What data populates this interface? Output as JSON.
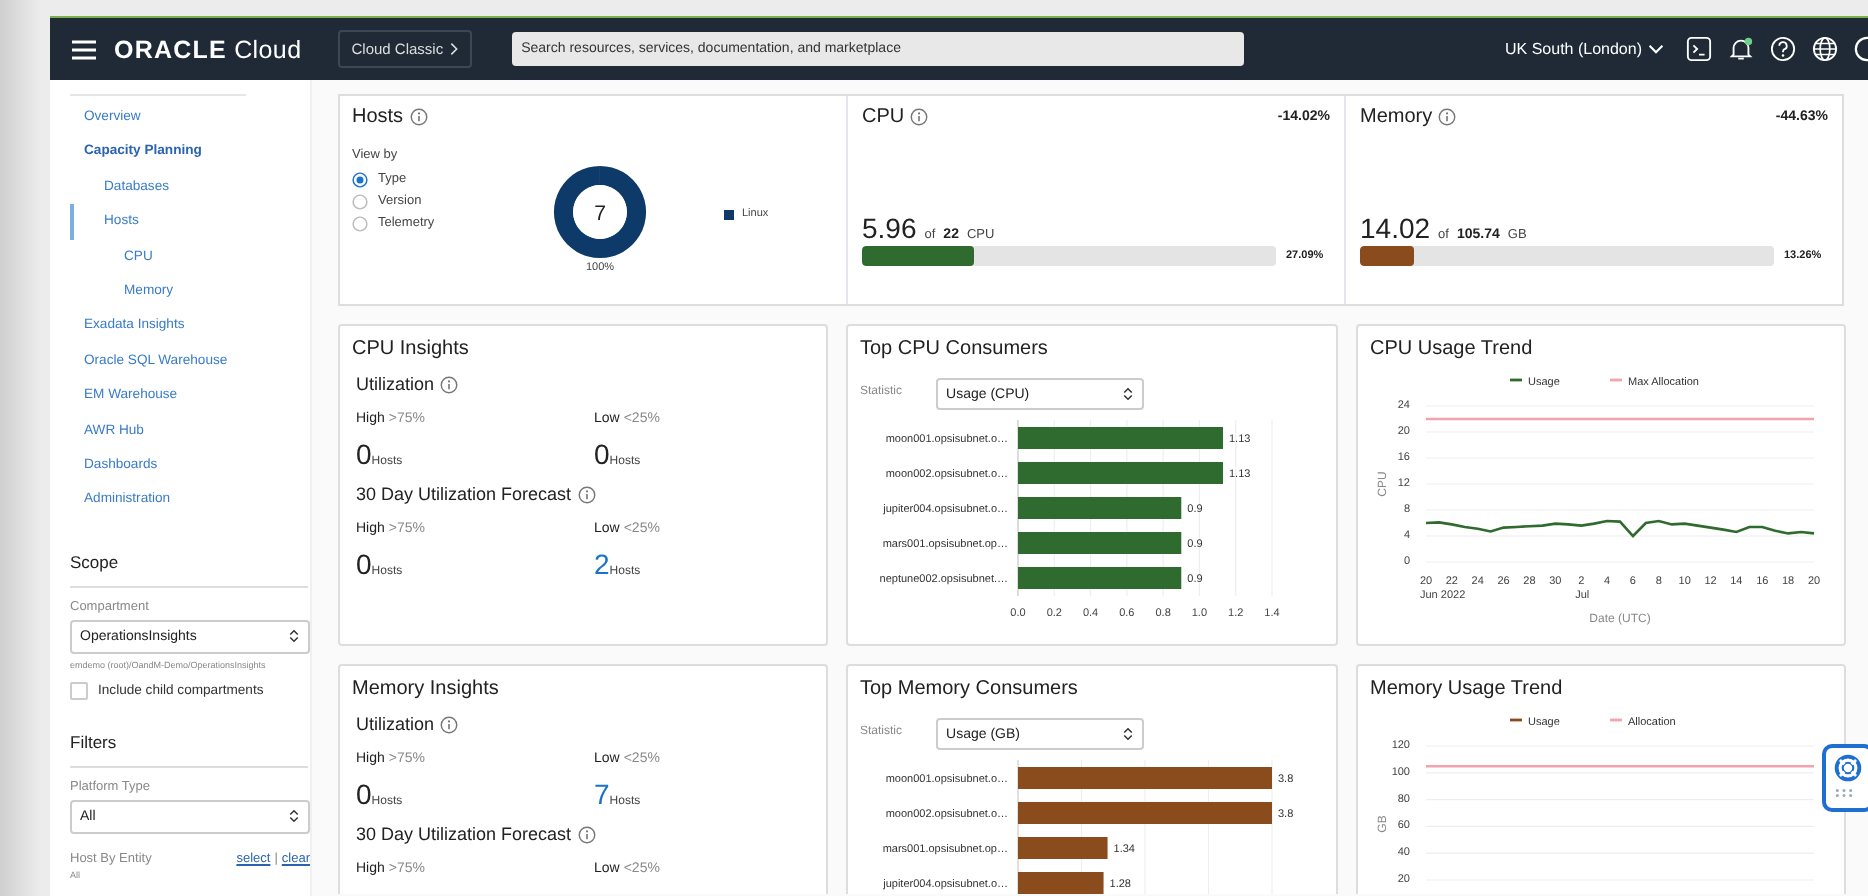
{
  "top_bar": {
    "logo": "**ORACLE** Cloud",
    "classic_button": "Cloud Classic",
    "search": {
      "placeholder": "Search resources, services, documentation, and marketplace"
    },
    "region": "UK South (London)"
  },
  "sidebar": {
    "nav": [
      {
        "label": "Overview",
        "active": false,
        "selected": false
      },
      {
        "label": "Capacity Planning",
        "active": true,
        "selected": false,
        "children": [
          {
            "label": "Databases",
            "active": false,
            "selected": false
          },
          {
            "label": "Hosts",
            "active": false,
            "selected": true,
            "children": [
              {
                "label": "CPU",
                "active": false,
                "selected": false
              },
              {
                "label": "Memory",
                "active": false,
                "selected": false
              }
            ]
          }
        ]
      },
      {
        "label": "Exadata Insights",
        "active": false,
        "selected": false
      },
      {
        "label": "Oracle SQL Warehouse",
        "active": false,
        "selected": false
      },
      {
        "label": "EM Warehouse",
        "active": false,
        "selected": false
      },
      {
        "label": "AWR Hub",
        "active": false,
        "selected": false
      },
      {
        "label": "Dashboards",
        "active": false,
        "selected": false
      },
      {
        "label": "Administration",
        "active": false,
        "selected": false
      }
    ],
    "scope": {
      "heading": "Scope",
      "compartment_label": "Compartment",
      "compartment_value": "OperationsInsights",
      "compartment_path": "emdemo (root)/OandM-Demo/OperationsInsights",
      "include_child": {
        "label": "Include child compartments",
        "checked": false
      }
    },
    "filters": {
      "heading": "Filters",
      "platform_label": "Platform Type",
      "platform_value": "All",
      "host_label": "Host By Entity",
      "select_link": "select",
      "separator": "|",
      "clear_link": "clear",
      "host_value": "All"
    }
  },
  "hosts": {
    "title": "Hosts",
    "view_by_label": "View by",
    "options": [
      {
        "label": "Type",
        "selected": true
      },
      {
        "label": "Version",
        "selected": false
      },
      {
        "label": "Telemetry",
        "selected": false
      }
    ],
    "share": "100%",
    "chart_data": {
      "type": "donut",
      "categories": [
        "Linux"
      ],
      "values": [
        7
      ],
      "data_labels": true
    }
  },
  "metrics": [
    {
      "title": "CPU",
      "change": "-14.02%",
      "used": "5.96",
      "of": "of",
      "capacity": "22",
      "unit": "CPU",
      "level": 0.2709,
      "percent": "27.09%",
      "color": "#2f6b2f"
    },
    {
      "title": "Memory",
      "change": "-44.63%",
      "used": "14.02",
      "of": "of",
      "capacity": "105.74",
      "unit": "GB",
      "level": 0.1326,
      "percent": "13.26%",
      "color": "#8a4b1d"
    }
  ],
  "insights": [
    {
      "title": "CPU Insights",
      "groups": [
        {
          "title": "Utilization",
          "cells": [
            {
              "label": "High",
              "threshold": ">75%",
              "value": "0",
              "unit": "Hosts",
              "link": false
            },
            {
              "label": "Low",
              "threshold": "<25%",
              "value": "0",
              "unit": "Hosts",
              "link": false
            }
          ]
        },
        {
          "title": "30 Day Utilization Forecast",
          "cells": [
            {
              "label": "High",
              "threshold": ">75%",
              "value": "0",
              "unit": "Hosts",
              "link": false
            },
            {
              "label": "Low",
              "threshold": "<25%",
              "value": "2",
              "unit": "Hosts",
              "link": true
            }
          ]
        }
      ]
    },
    {
      "title": "Memory Insights",
      "groups": [
        {
          "title": "Utilization",
          "cells": [
            {
              "label": "High",
              "threshold": ">75%",
              "value": "0",
              "unit": "Hosts",
              "link": false
            },
            {
              "label": "Low",
              "threshold": "<25%",
              "value": "7",
              "unit": "Hosts",
              "link": true
            }
          ]
        },
        {
          "title": "30 Day Utilization Forecast",
          "cells": [
            {
              "label": "High",
              "threshold": ">75%"
            },
            {
              "label": "Low",
              "threshold": "<25%"
            }
          ]
        }
      ]
    }
  ],
  "consumers": [
    {
      "title": "Top CPU Consumers",
      "statistic_label": "Statistic",
      "chart_data": {
        "type": "bar",
        "orientation": "horizontal",
        "grid": true,
        "categories": [
          "moon001.opsisubnet.o…",
          "moon002.opsisubnet.o…",
          "jupiter004.opsisubnet.o…",
          "mars001.opsisubnet.op…",
          "neptune002.opsisubnet.…"
        ],
        "series": [
          {
            "name": "Usage (CPU)",
            "color": "#2f6b2f",
            "values": [
              1.13,
              1.13,
              0.9,
              0.9,
              0.9
            ]
          }
        ],
        "xlim": [
          0,
          1.4
        ],
        "xticks": [
          {
            "value": 0,
            "label": "0.0"
          },
          0.2,
          0.4,
          0.6,
          0.8,
          {
            "value": 1,
            "label": "1.0"
          },
          1.2,
          1.4
        ],
        "data_labels": true
      }
    },
    {
      "title": "Top Memory Consumers",
      "statistic_label": "Statistic",
      "chart_data": {
        "type": "bar",
        "orientation": "horizontal",
        "grid": true,
        "categories": [
          "moon001.opsisubnet.o…",
          "moon002.opsisubnet.o…",
          "mars001.opsisubnet.op…",
          "jupiter004.opsisubnet.o…"
        ],
        "series": [
          {
            "name": "Usage (GB)",
            "color": "#8a4b1d",
            "values": [
              3.8,
              3.8,
              1.34,
              1.28
            ]
          }
        ],
        "data_labels": true
      }
    }
  ],
  "trends": [
    {
      "title": "CPU Usage Trend",
      "chart_data": {
        "type": "line",
        "grid": true,
        "ylabel": "CPU",
        "xlabel": "Date (UTC)",
        "ylim": [
          0,
          24
        ],
        "yticks": [
          0,
          4,
          8,
          12,
          16,
          20,
          24
        ],
        "legend": "top",
        "annotations": [
          "Jun 2022",
          "Jul"
        ],
        "categories": [
          "20",
          null,
          "22",
          null,
          "24",
          null,
          "26",
          null,
          "28",
          null,
          "30",
          null,
          "2",
          null,
          "4",
          null,
          "6",
          null,
          "8",
          null,
          "10",
          null,
          "12",
          null,
          "14",
          null,
          "16",
          null,
          "18",
          null,
          "20"
        ],
        "series": [
          {
            "name": "Usage",
            "color": "#2f6b2f",
            "values": [
              6,
              6.1,
              5.8,
              5.4,
              5.1,
              4.7,
              5.3,
              5.4,
              5.5,
              5.6,
              5.9,
              5.8,
              5.6,
              5.9,
              6.3,
              6.2,
              4,
              6,
              6.3,
              5.8,
              5.9,
              5.6,
              5.3,
              5,
              4.6,
              5.4,
              5.4,
              4.8,
              4.4,
              4.6,
              4.4
            ]
          },
          {
            "name": "Max Allocation",
            "color": "#f2a3ab",
            "values": [
              22,
              22,
              22,
              22,
              22,
              22,
              22,
              22,
              22,
              22,
              22,
              22,
              22,
              22,
              22,
              22,
              22,
              22,
              22,
              22,
              22,
              22,
              22,
              22,
              22,
              22,
              22,
              22,
              22,
              22,
              22
            ]
          }
        ]
      }
    },
    {
      "title": "Memory Usage Trend",
      "chart_data": {
        "type": "line",
        "grid": true,
        "legend": "top",
        "ylabel": "GB",
        "ylim": [
          20,
          120
        ],
        "yticks": [
          20,
          40,
          60,
          80,
          100,
          120
        ],
        "series": [
          {
            "name": "Usage",
            "color": "#8a4b1d",
            "values": [
              null,
              null,
              null,
              null,
              null,
              null,
              null,
              null,
              null,
              null,
              null,
              null,
              null,
              null,
              null,
              null,
              null,
              null,
              null,
              null,
              null,
              null,
              null,
              null,
              null,
              null,
              null,
              null,
              null,
              null,
              null
            ]
          },
          {
            "name": "Allocation",
            "color": "#f2a3ab",
            "values": [
              105,
              105,
              105,
              105,
              105,
              105,
              105,
              105,
              105,
              105,
              105,
              105,
              105,
              105,
              105,
              105,
              105,
              105,
              105,
              105,
              105,
              105,
              105,
              105,
              105,
              105,
              105,
              105,
              105,
              105,
              105
            ]
          }
        ]
      }
    }
  ]
}
